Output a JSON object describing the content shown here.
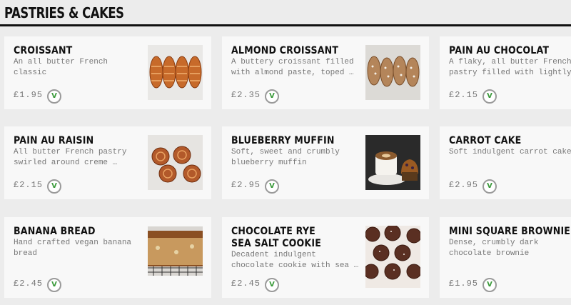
{
  "section": {
    "title": "PASTRIES & CAKES"
  },
  "veg_symbol": "V",
  "products": [
    {
      "name": "CROISSANT",
      "description": "An all butter French\nclassic",
      "price": "£1.95",
      "image_icon": "croissant-photo"
    },
    {
      "name": "ALMOND CROISSANT",
      "description": "A buttery croissant filled\nwith almond paste, toped …",
      "price": "£2.35",
      "image_icon": "almond-croissant-photo"
    },
    {
      "name": "PAIN AU CHOCOLAT",
      "description": "A flaky, all butter French\npastry filled with lightly…",
      "price": "£2.15",
      "image_icon": ""
    },
    {
      "name": "PAIN AU RAISIN",
      "description": "All butter French pastry\nswirled around creme …",
      "price": "£2.15",
      "image_icon": "pain-au-raisin-photo"
    },
    {
      "name": "BLUEBERRY MUFFIN",
      "description": "Soft, sweet and crumbly\nblueberry muffin",
      "price": "£2.95",
      "image_icon": "blueberry-muffin-photo"
    },
    {
      "name": "CARROT CAKE",
      "description": "Soft indulgent carrot cake.",
      "price": "£2.95",
      "image_icon": ""
    },
    {
      "name": "BANANA BREAD",
      "description": "Hand crafted vegan banana\nbread",
      "price": "£2.45",
      "image_icon": "banana-bread-photo"
    },
    {
      "name": "CHOCOLATE RYE SEA SALT COOKIE",
      "description": "Decadent indulgent\nchocolate cookie with sea …",
      "price": "£2.45",
      "image_icon": "chocolate-cookie-photo"
    },
    {
      "name": "MINI SQUARE BROWNIE",
      "description": "Dense, crumbly dark\nchocolate brownie",
      "price": "£1.95",
      "image_icon": ""
    }
  ],
  "colors": {
    "background": "#ececec",
    "card": "#f8f8f8",
    "veg_green": "#3a9a3a",
    "text_dark": "#111111",
    "text_muted": "#777777"
  }
}
